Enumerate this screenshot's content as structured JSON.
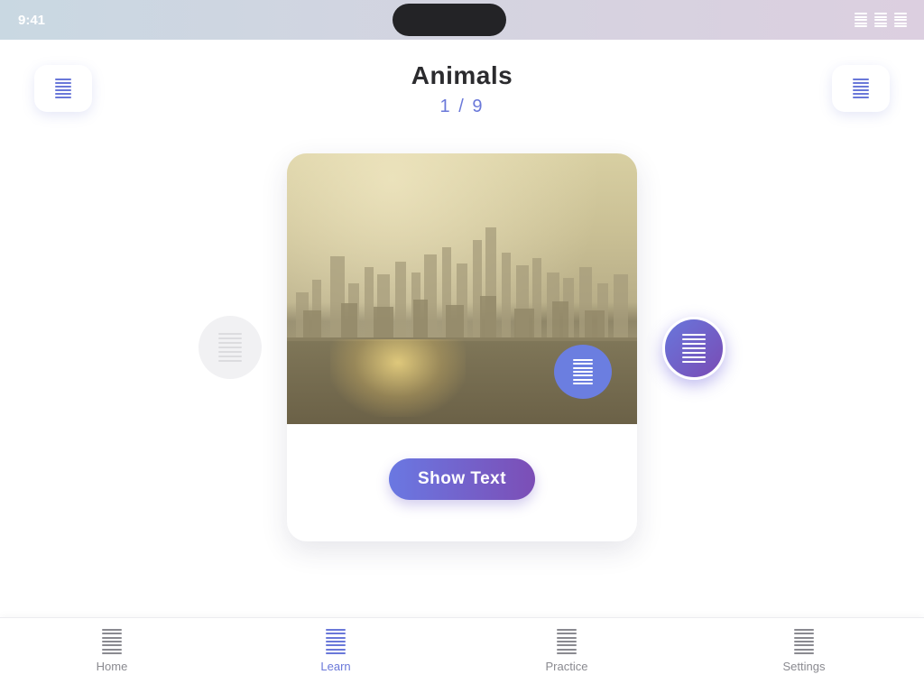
{
  "status_bar": {
    "time": "9:41",
    "icons": [
      "signal-icon",
      "wifi-icon",
      "battery-icon"
    ]
  },
  "header": {
    "title": "Animals",
    "progress": "1 / 9",
    "left_button_icon": "menu-icon",
    "right_button_icon": "options-icon"
  },
  "card": {
    "image_description_icon": "card-image",
    "audio_icon": "speaker-icon",
    "show_text_label": "Show Text"
  },
  "navigation": {
    "previous_icon": "chevron-left-icon",
    "next_icon": "chevron-right-icon"
  },
  "bottom_nav": {
    "items": [
      {
        "label": "Home",
        "icon": "home-icon",
        "active": false
      },
      {
        "label": "Learn",
        "icon": "book-icon",
        "active": true
      },
      {
        "label": "Practice",
        "icon": "practice-icon",
        "active": false
      },
      {
        "label": "Settings",
        "icon": "gear-icon",
        "active": false
      }
    ]
  },
  "colors": {
    "accent": "#6a78d9",
    "accent_gradient_end": "#7c4eb6",
    "inactive": "#8a8a90",
    "title": "#2b2b2e"
  }
}
